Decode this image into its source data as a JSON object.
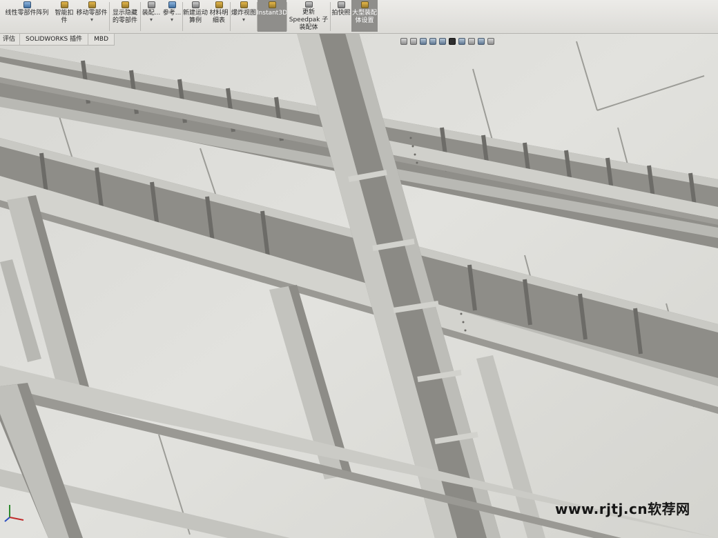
{
  "ribbon": {
    "buttons": [
      {
        "label": "线性零部件阵列",
        "icon": "linear-pattern-icon"
      },
      {
        "label": "智能扣件",
        "icon": "smart-fastener-icon"
      },
      {
        "label": "移动零部件",
        "icon": "move-component-icon"
      },
      {
        "label": "显示隐藏的零部件",
        "icon": "show-hidden-icon"
      },
      {
        "label": "装配...",
        "icon": "assembly-feature-icon"
      },
      {
        "label": "参考...",
        "icon": "reference-geometry-icon"
      },
      {
        "label": "新建运动算例",
        "icon": "motion-study-icon"
      },
      {
        "label": "材料明细表",
        "icon": "bom-icon"
      },
      {
        "label": "爆炸视图",
        "icon": "exploded-view-icon"
      },
      {
        "label": "Instant3D",
        "icon": "instant3d-icon"
      },
      {
        "label": "更新 Speedpak 子装配体",
        "icon": "speedpak-icon"
      },
      {
        "label": "拍快照",
        "icon": "camera-icon"
      },
      {
        "label": "大型装配体设置",
        "icon": "large-assembly-icon"
      }
    ]
  },
  "tabs": [
    "评估",
    "SOLIDWORKS 插件",
    "MBD"
  ],
  "watermark": "www.rjtj.cn软荐网",
  "colors": {
    "background": "#d9d9d5",
    "steel_face": "#c6c6c1",
    "steel_shadow": "#8a8984",
    "steel_edge": "#5f5f5a"
  }
}
